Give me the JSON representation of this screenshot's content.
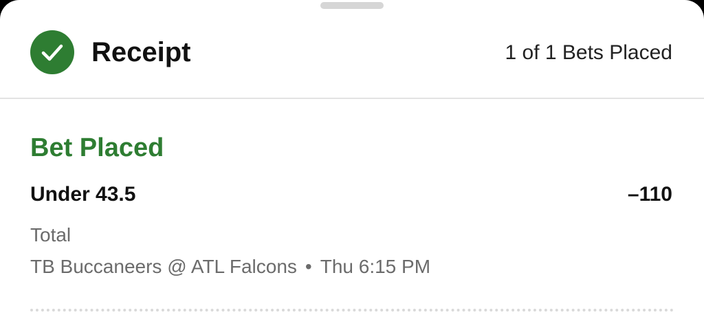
{
  "header": {
    "title": "Receipt",
    "bets_placed": "1 of 1 Bets Placed"
  },
  "bet": {
    "status": "Bet Placed",
    "selection": "Under 43.5",
    "odds": "–110",
    "market": "Total",
    "matchup": "TB Buccaneers @ ATL Falcons",
    "separator": "•",
    "start_time": "Thu 6:15 PM"
  },
  "icons": {
    "status_icon": "checkmark-circle-icon"
  },
  "colors": {
    "success_green": "#2e7d32",
    "secondary_text": "#6b6b6b"
  }
}
